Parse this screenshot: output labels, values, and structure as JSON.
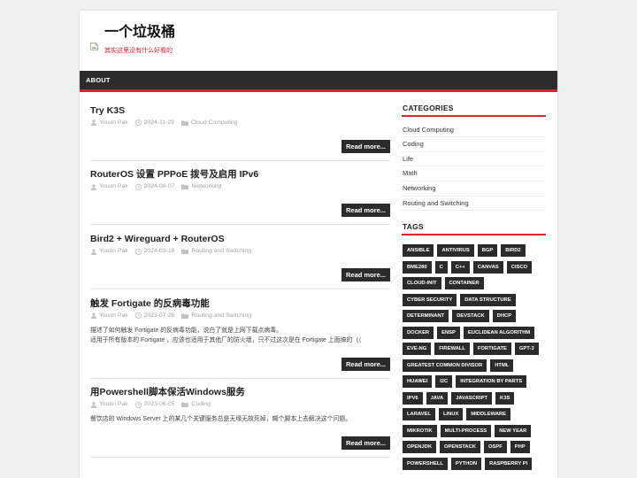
{
  "site": {
    "title": "一个垃圾桶",
    "tagline": "其实这里没有什么好看的",
    "logo_icon": "broken-image-icon"
  },
  "nav": {
    "items": [
      {
        "label": "ABOUT"
      }
    ]
  },
  "icons": {
    "author": "user-icon",
    "date": "clock-icon",
    "category": "folder-icon"
  },
  "colors": {
    "accent": "#e4202d",
    "dark": "#2b2b2b",
    "page_bg": "#f0f0f0"
  },
  "posts": [
    {
      "title": "Try K3S",
      "author": "Youon Pak",
      "date": "2024-11-29",
      "category": "Cloud Computing",
      "read_more": "Read more..."
    },
    {
      "title": "RouterOS 设置 PPPoE 拨号及启用 IPv6",
      "author": "Youon Pak",
      "date": "2024-08-07",
      "category": "Networking",
      "read_more": "Read more..."
    },
    {
      "title": "Bird2 + Wireguard + RouterOS",
      "author": "Youon Pak",
      "date": "2024-03-18",
      "category": "Routing and Switching",
      "read_more": "Read more..."
    },
    {
      "title": "触发 Fortigate 的反病毒功能",
      "author": "Youon Pak",
      "date": "2023-07-26",
      "category": "Routing and Switching",
      "excerpt": [
        "描述了如何触发 Fortigate 的反病毒功能，说白了就是上网下载点病毒。",
        "适用于所有版本的 Fortigate ，应该也适用于其他厂的防火墙，只不过这次是在 Fortigate 上面搞的（（"
      ],
      "read_more": "Read more..."
    },
    {
      "title": "用Powershell脚本保活Windows服务",
      "author": "Youon Pak",
      "date": "2023-06-05",
      "category": "Coding",
      "excerpt": [
        "餐饮店的 Windows Server 上的某几个关键服务总是无缘无故死掉，糊个脚本上去解决这个问题。"
      ],
      "read_more": "Read more..."
    }
  ],
  "sidebar": {
    "categories": {
      "heading": "CATEGORIES",
      "items": [
        "Cloud Computing",
        "Coding",
        "Life",
        "Math",
        "Networking",
        "Routing and Switching"
      ]
    },
    "tags": {
      "heading": "TAGS",
      "items": [
        "ANSIBLE",
        "ANTIVIRUS",
        "BGP",
        "BIRD2",
        "BME280",
        "C",
        "C++",
        "CANVAS",
        "CISCO",
        "CLOUD-INIT",
        "CONTAINER",
        "CYBER SECURITY",
        "DATA STRUCTURE",
        "DETERMINANT",
        "DEVSTACK",
        "DHCP",
        "DOCKER",
        "ENSP",
        "EUCLIDEAN ALGORITHM",
        "EVE-NG",
        "FIREWALL",
        "FORTIGATE",
        "GPT-3",
        "GREATEST COMMON DIVISOR",
        "HTML",
        "HUAWEI",
        "I2C",
        "INTEGRATION BY PARTS",
        "IPV6",
        "JAVA",
        "JAVASCRIPT",
        "K3S",
        "LARAVEL",
        "LINUX",
        "MIDDLEWARE",
        "MIKROTIK",
        "MULTI-PROCESS",
        "NEW YEAR",
        "OPENJDK",
        "OPENSTACK",
        "OSPF",
        "PHP",
        "POWERSHELL",
        "PYTHON",
        "RASPBERRY PI"
      ]
    }
  }
}
